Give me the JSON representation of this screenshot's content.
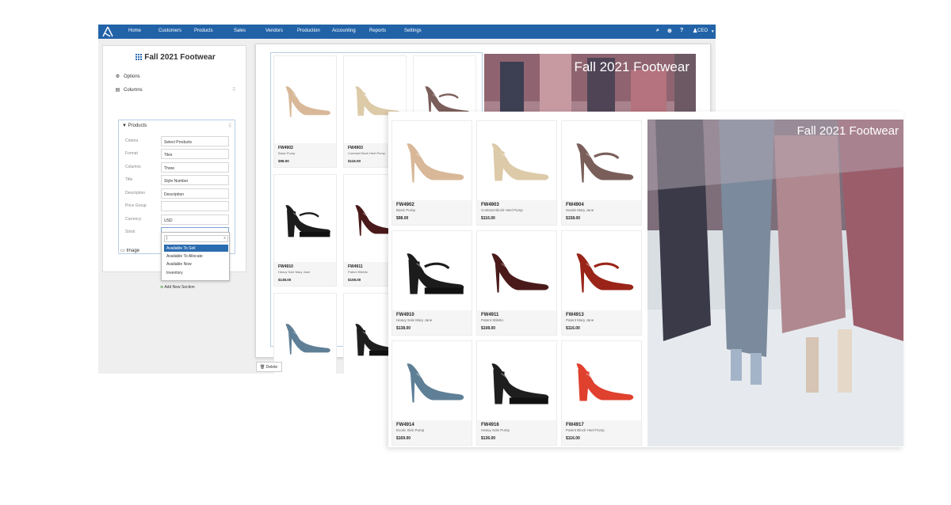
{
  "nav": {
    "items": [
      "Home",
      "Customers",
      "Products",
      "Sales",
      "Vendors",
      "Production",
      "Accounting",
      "Reports",
      "Settings"
    ],
    "user_label": "CEO"
  },
  "config": {
    "title": "Fall 2021 Footwear",
    "options_label": "Options",
    "columns_label": "Columns",
    "products_label": "Products",
    "fields": [
      {
        "label": "Criteria",
        "value": "Select Products"
      },
      {
        "label": "Format",
        "value": "Tiles"
      },
      {
        "label": "Columns",
        "value": "Three"
      },
      {
        "label": "Title",
        "value": "Style Number"
      },
      {
        "label": "Description",
        "value": "Description"
      },
      {
        "label": "Price Group",
        "value": ""
      },
      {
        "label": "Currency",
        "value": "USD"
      },
      {
        "label": "Stock",
        "value": ""
      }
    ],
    "stock_search_value": "|",
    "stock_options": [
      "Available To Sell",
      "Available To Allocate",
      "Available Now",
      "Inventory"
    ],
    "stock_selected": "Available To Sell",
    "image_label": "Image",
    "add_section_label": "Add New Section",
    "delete_label": "Delete"
  },
  "catalog": {
    "banner_title": "Fall 2021 Footwear",
    "products": [
      {
        "code": "FW4902",
        "desc": "Basic Pump",
        "price": "$98.00",
        "style": "pump",
        "color": "#d8b898"
      },
      {
        "code": "FW4903",
        "desc": "Contrast Block Heel Pump",
        "price": "$116.00",
        "style": "block",
        "color": "#dccaa8"
      },
      {
        "code": "FW4904",
        "desc": "Suede Mary Jane",
        "price": "$158.00",
        "style": "mary",
        "color": "#7a5e5a"
      },
      {
        "code": "FW4910",
        "desc": "Heavy Sole Mary Jane",
        "price": "$138.00",
        "style": "mary-heavy",
        "color": "#1c1c1c"
      },
      {
        "code": "FW4911",
        "desc": "Patent Stiletto",
        "price": "$108.00",
        "style": "stiletto",
        "color": "#4a1a1a"
      },
      {
        "code": "FW4913",
        "desc": "Patent Mary Jane",
        "price": "$116.00",
        "style": "mary",
        "color": "#9a2418"
      },
      {
        "code": "FW4914",
        "desc": "Exotic Skin Pump",
        "price": "$169.00",
        "style": "stiletto",
        "color": "#5f7f96"
      },
      {
        "code": "FW4916",
        "desc": "Heavy Sole Pump",
        "price": "$136.00",
        "style": "block-heavy",
        "color": "#1e1e1e"
      },
      {
        "code": "FW4917",
        "desc": "Patent Block Heel Pump",
        "price": "$116.00",
        "style": "block",
        "color": "#e0402e"
      }
    ]
  },
  "colors": {
    "nav_bg": "#2263a8",
    "accent": "#2b6cb0"
  }
}
